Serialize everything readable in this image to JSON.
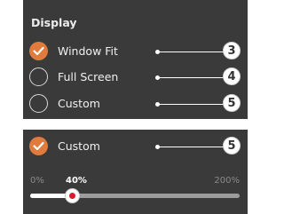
{
  "display": {
    "title": "Display",
    "options": [
      {
        "label": "Window Fit",
        "selected": true,
        "callout": "3"
      },
      {
        "label": "Full Screen",
        "selected": false,
        "callout": "4"
      },
      {
        "label": "Custom",
        "selected": false,
        "callout": "5"
      }
    ]
  },
  "custom_panel": {
    "option": {
      "label": "Custom",
      "selected": true,
      "callout": "5"
    },
    "slider": {
      "min_label": "0%",
      "max_label": "200%",
      "value_label": "40%",
      "value_percent": 40,
      "range_percent": [
        0,
        200
      ]
    }
  },
  "colors": {
    "panel_background": "#3a3a3a",
    "accent": "#e07b3d",
    "slider_thumb_center": "#e0182a",
    "callout": "#ffffff"
  }
}
